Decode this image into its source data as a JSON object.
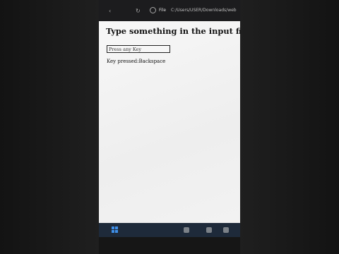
{
  "browser": {
    "back_glyph": "‹",
    "reload_glyph": "↻",
    "file_label": "File",
    "url": "C:/Users/USER/Downloads/web"
  },
  "page": {
    "heading": "Type something in the input field:",
    "input_value": "Press any Key",
    "result_text": "Key pressed:Backspace"
  },
  "taskbar": {
    "icons": [
      "windows-logo",
      "search-icon",
      "app-icon",
      "app-icon"
    ]
  },
  "colors": {
    "browser_bar": "#1c1c1e",
    "page_bg": "#f3f3f3",
    "taskbar": "#1e2a3a",
    "backdrop": "#1b1b1b"
  }
}
